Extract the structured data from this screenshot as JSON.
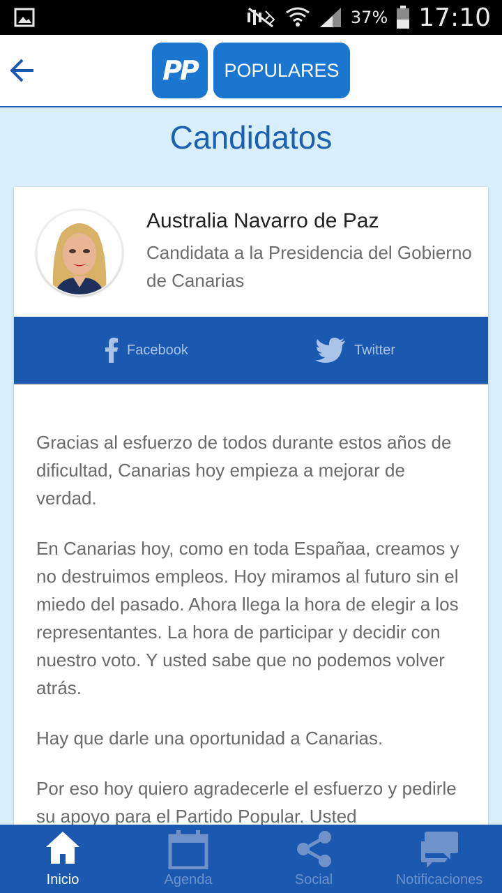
{
  "status_bar": {
    "battery": "37%",
    "time": "17:10"
  },
  "header": {
    "logo_mark": "PP",
    "logo_text": "POPULARES"
  },
  "page": {
    "title": "Candidatos"
  },
  "candidate": {
    "name": "Australia Navarro de Paz",
    "role": "Candidata a la Presidencia del Gobierno de Canarias"
  },
  "social": {
    "facebook_label": "Facebook",
    "twitter_label": "Twitter"
  },
  "bio": {
    "paragraphs": [
      "Gracias al esfuerzo de todos durante estos años de dificultad, Canarias hoy empieza a mejorar de verdad.",
      "En Canarias hoy, como en toda Españaa, creamos y no destruimos empleos. Hoy miramos al futuro sin el miedo del pasado. Ahora llega la hora de elegir a los representantes. La hora de participar y decidir con nuestro voto. Y usted sabe que no podemos volver atrás.",
      "Hay que darle una oportunidad a Canarias.",
      "Por eso hoy quiero agradecerle el esfuerzo y pedirle su apoyo para el Partido Popular. Usted"
    ]
  },
  "nav": {
    "items": [
      {
        "label": "Inicio",
        "icon": "home-icon",
        "active": true
      },
      {
        "label": "Agenda",
        "icon": "calendar-icon",
        "active": false
      },
      {
        "label": "Social",
        "icon": "share-icon",
        "active": false
      },
      {
        "label": "Notificaciones",
        "icon": "chat-icon",
        "active": false
      }
    ]
  },
  "colors": {
    "brand_blue": "#1b58b0",
    "logo_blue": "#1b76cf",
    "page_bg": "#d8eefa"
  }
}
